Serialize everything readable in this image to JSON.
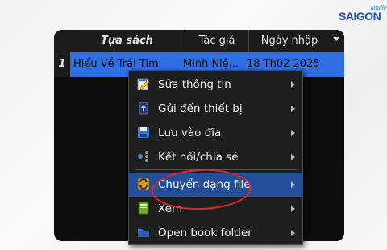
{
  "brand": {
    "main": "SAIGON",
    "sub": "kindle"
  },
  "table": {
    "columns": [
      "Tựa sách",
      "Tác giả",
      "Ngày nhập"
    ],
    "row": {
      "index": "1",
      "title": "Hiểu Về Trái Tim",
      "author": "Minh Niệ...",
      "date": "18 Th02 2025"
    }
  },
  "context_menu": {
    "items": [
      {
        "label": "Sửa thông tin",
        "icon": "edit-icon"
      },
      {
        "label": "Gửi đến thiết bị",
        "icon": "send-device-icon"
      },
      {
        "label": "Lưu vào đĩa",
        "icon": "save-disk-icon"
      },
      {
        "label": "Kết nối/chia sẻ",
        "icon": "share-icon"
      },
      {
        "label": "Chuyển dạng file",
        "icon": "convert-icon",
        "highlighted": true
      },
      {
        "label": "Xem",
        "icon": "view-book-icon"
      },
      {
        "label": "Open book folder",
        "icon": "folder-icon"
      }
    ]
  },
  "colors": {
    "selection": "#2f6fe4",
    "menu_highlight": "#234e9a",
    "annotation_circle": "#e0262a"
  }
}
